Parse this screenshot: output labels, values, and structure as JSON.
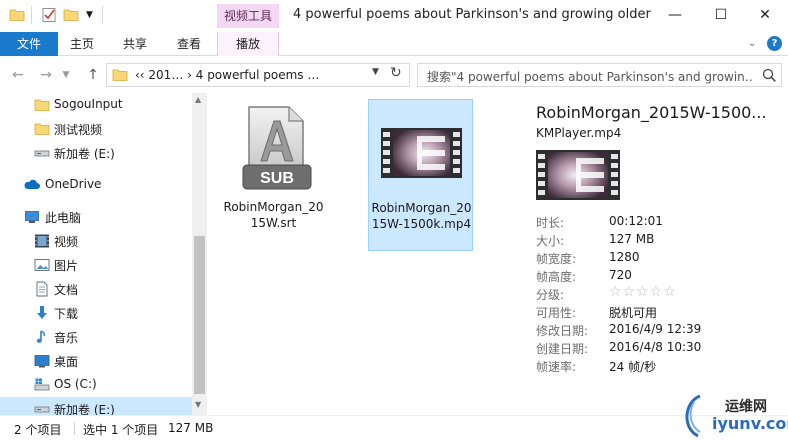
{
  "titlebar": {
    "contextual_tab_header": "视频工具",
    "window_title": "4 powerful poems about Parkinson's and growing older"
  },
  "ribbon": {
    "tabs": [
      "文件",
      "主页",
      "共享",
      "查看",
      "播放"
    ]
  },
  "navigation": {
    "address_text": "‹‹  201…  ›  4 powerful poems …",
    "search_placeholder": "搜索\"4 powerful poems about Parkinson's and growin…"
  },
  "sidebar": {
    "items": [
      {
        "label": "SogouInput",
        "icon": "folder-icon"
      },
      {
        "label": "测试视频",
        "icon": "folder-icon"
      },
      {
        "label": "新加卷 (E:)",
        "icon": "drive-icon"
      },
      {
        "label": "OneDrive",
        "icon": "cloud-icon"
      },
      {
        "label": "此电脑",
        "icon": "computer-icon"
      },
      {
        "label": "视频",
        "icon": "video-folder-icon"
      },
      {
        "label": "图片",
        "icon": "pictures-folder-icon"
      },
      {
        "label": "文档",
        "icon": "documents-folder-icon"
      },
      {
        "label": "下载",
        "icon": "downloads-folder-icon"
      },
      {
        "label": "音乐",
        "icon": "music-folder-icon"
      },
      {
        "label": "桌面",
        "icon": "desktop-folder-icon"
      },
      {
        "label": "OS (C:)",
        "icon": "windows-drive-icon"
      },
      {
        "label": "新加卷 (E:)",
        "icon": "drive-icon"
      }
    ]
  },
  "files": [
    {
      "name": "RobinMorgan_2015W.srt",
      "icon": "subtitle-file-icon",
      "thumb_text": "SUB",
      "selected": false
    },
    {
      "name": "RobinMorgan_2015W-1500k.mp4",
      "icon": "video-file-icon",
      "selected": true
    }
  ],
  "details": {
    "title": "RobinMorgan_2015W-1500...",
    "subtitle": "KMPlayer.mp4",
    "props": [
      {
        "key": "时长:",
        "value": "00:12:01"
      },
      {
        "key": "大小:",
        "value": "127 MB"
      },
      {
        "key": "帧宽度:",
        "value": "1280"
      },
      {
        "key": "帧高度:",
        "value": "720"
      },
      {
        "key": "分级:",
        "value": "",
        "rating": 0,
        "rating_max": 5
      },
      {
        "key": "可用性:",
        "value": "脱机可用"
      },
      {
        "key": "修改日期:",
        "value": "2016/4/9 12:39"
      },
      {
        "key": "创建日期:",
        "value": "2016/4/8 10:30"
      },
      {
        "key": "帧速率:",
        "value": "24 帧/秒"
      }
    ]
  },
  "status": {
    "item_count": "2 个项目",
    "selection": "选中 1 个项目",
    "size": "127 MB"
  },
  "watermark": {
    "line1": "运维网",
    "line2": "iyunv.com"
  },
  "colors": {
    "accent": "#1979ca",
    "selection": "#cce8ff",
    "contextual": "#f4d7f0"
  }
}
